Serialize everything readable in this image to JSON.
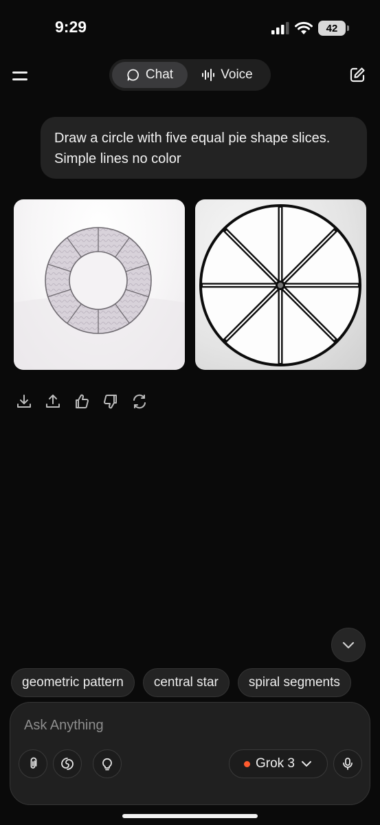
{
  "status_bar": {
    "time": "9:29",
    "battery": "42"
  },
  "header": {
    "tabs": [
      {
        "label": "Chat",
        "icon": "chat-bubble-icon",
        "active": true
      },
      {
        "label": "Voice",
        "icon": "voice-wave-icon",
        "active": false
      }
    ]
  },
  "conversation": {
    "user_message_line1": "Draw a circle with five equal pie shape slices.",
    "user_message_line2": "Simple lines no color",
    "images": [
      {
        "name": "ring-segments-image"
      },
      {
        "name": "pie-eight-slices-image"
      }
    ],
    "actions": [
      "download-icon",
      "share-icon",
      "thumbs-up-icon",
      "thumbs-down-icon",
      "regenerate-icon"
    ]
  },
  "suggestions": [
    "geometric pattern",
    "central star",
    "spiral segments"
  ],
  "composer": {
    "placeholder": "Ask Anything",
    "model": "Grok 3",
    "accent_color": "#ff5b2e"
  }
}
